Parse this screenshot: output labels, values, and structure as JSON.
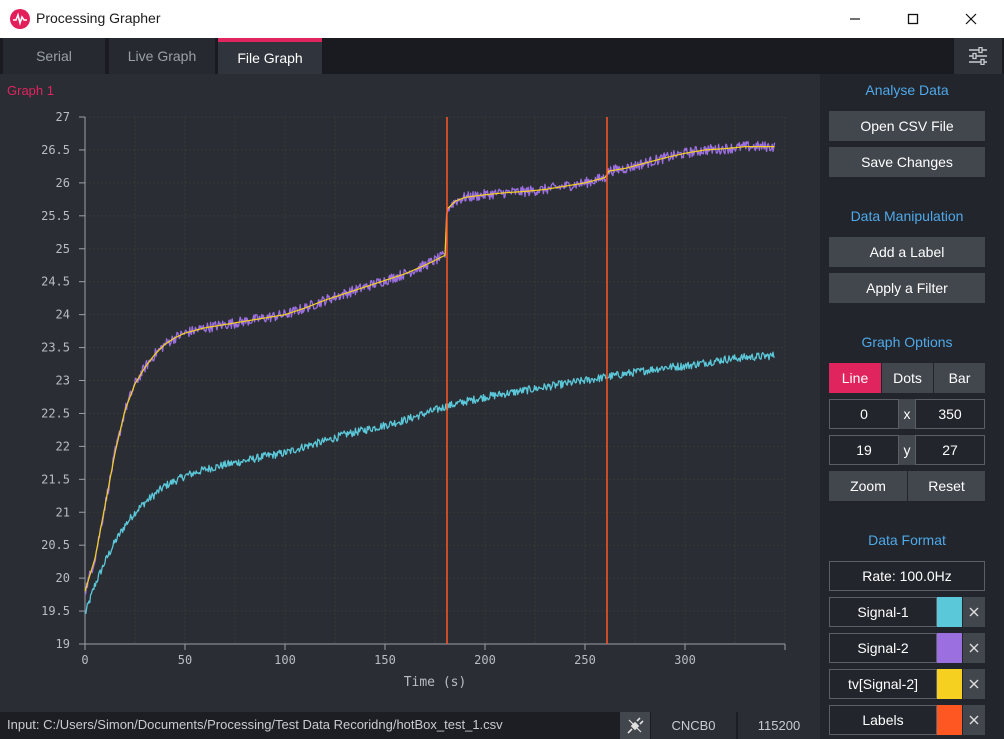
{
  "window": {
    "title": "Processing Grapher"
  },
  "tabs": [
    {
      "label": "Serial",
      "active": false
    },
    {
      "label": "Live Graph",
      "active": false
    },
    {
      "label": "File Graph",
      "active": true
    }
  ],
  "graph": {
    "label": "Graph 1"
  },
  "chart_data": {
    "type": "line",
    "title": "",
    "xlabel": "Time (s)",
    "ylabel": "",
    "xlim": [
      0,
      350
    ],
    "ylim": [
      19,
      27
    ],
    "x_ticks": [
      0,
      50,
      100,
      150,
      200,
      250,
      300
    ],
    "y_ticks": [
      19,
      19.5,
      20,
      20.5,
      21,
      21.5,
      22,
      22.5,
      23,
      23.5,
      24,
      24.5,
      25,
      25.5,
      26,
      26.5,
      27
    ],
    "grid": true,
    "markers": [
      181,
      261
    ],
    "marker_color": "#ff5722",
    "series": [
      {
        "name": "Signal-1",
        "color": "#5bc8d9",
        "noise": 0.06,
        "x": [
          0,
          5,
          10,
          15,
          20,
          25,
          30,
          40,
          50,
          60,
          70,
          80,
          90,
          100,
          110,
          120,
          130,
          140,
          150,
          160,
          170,
          180,
          190,
          200,
          210,
          220,
          230,
          240,
          250,
          260,
          270,
          280,
          290,
          300,
          310,
          320,
          330,
          345
        ],
        "y": [
          19.45,
          19.9,
          20.25,
          20.55,
          20.8,
          21.0,
          21.15,
          21.4,
          21.55,
          21.65,
          21.72,
          21.78,
          21.85,
          21.9,
          22.0,
          22.08,
          22.18,
          22.25,
          22.32,
          22.4,
          22.5,
          22.6,
          22.68,
          22.75,
          22.8,
          22.85,
          22.9,
          22.95,
          23.0,
          23.05,
          23.1,
          23.15,
          23.2,
          23.22,
          23.27,
          23.32,
          23.35,
          23.38
        ]
      },
      {
        "name": "Signal-2",
        "color": "#9b6fe0",
        "noise": 0.08,
        "x": [
          0,
          5,
          10,
          15,
          20,
          25,
          30,
          35,
          40,
          45,
          50,
          60,
          70,
          80,
          90,
          100,
          110,
          120,
          130,
          140,
          150,
          160,
          170,
          180,
          181,
          185,
          190,
          200,
          210,
          220,
          230,
          240,
          250,
          260,
          262,
          270,
          280,
          290,
          300,
          310,
          320,
          330,
          345
        ],
        "y": [
          19.8,
          20.3,
          21.1,
          21.9,
          22.55,
          22.95,
          23.2,
          23.4,
          23.55,
          23.65,
          23.72,
          23.8,
          23.85,
          23.9,
          23.95,
          24.0,
          24.1,
          24.22,
          24.32,
          24.42,
          24.52,
          24.62,
          24.75,
          24.9,
          25.6,
          25.72,
          25.78,
          25.82,
          25.85,
          25.87,
          25.9,
          25.95,
          26.0,
          26.08,
          26.18,
          26.22,
          26.3,
          26.38,
          26.45,
          26.5,
          26.52,
          26.55,
          26.55
        ]
      },
      {
        "name": "tv[Signal-2]",
        "color": "#f5d020",
        "noise": 0,
        "x": [
          0,
          5,
          10,
          15,
          20,
          25,
          30,
          35,
          40,
          45,
          50,
          60,
          70,
          80,
          90,
          100,
          110,
          120,
          130,
          140,
          150,
          160,
          170,
          180,
          181,
          185,
          190,
          200,
          210,
          220,
          230,
          240,
          250,
          260,
          262,
          270,
          280,
          290,
          300,
          310,
          320,
          330,
          345
        ],
        "y": [
          19.8,
          20.3,
          21.1,
          21.9,
          22.55,
          22.95,
          23.2,
          23.4,
          23.55,
          23.65,
          23.72,
          23.8,
          23.85,
          23.9,
          23.95,
          24.0,
          24.1,
          24.22,
          24.32,
          24.42,
          24.52,
          24.62,
          24.75,
          24.9,
          25.6,
          25.72,
          25.78,
          25.82,
          25.85,
          25.87,
          25.9,
          25.95,
          26.0,
          26.08,
          26.18,
          26.22,
          26.3,
          26.38,
          26.45,
          26.5,
          26.52,
          26.55,
          26.55
        ]
      }
    ]
  },
  "sidebar": {
    "analyse_heading": "Analyse Data",
    "open_csv": "Open CSV File",
    "save_changes": "Save Changes",
    "manip_heading": "Data Manipulation",
    "add_label": "Add a Label",
    "apply_filter": "Apply a Filter",
    "options_heading": "Graph Options",
    "graph_types": [
      "Line",
      "Dots",
      "Bar"
    ],
    "x_min": "0",
    "x_sep": "x",
    "x_max": "350",
    "y_min": "19",
    "y_sep": "y",
    "y_max": "27",
    "zoom": "Zoom",
    "reset": "Reset",
    "format_heading": "Data Format",
    "rate": "Rate: 100.0Hz",
    "signals": [
      {
        "name": "Signal-1",
        "color": "#5bc8d9"
      },
      {
        "name": "Signal-2",
        "color": "#9b6fe0"
      },
      {
        "name": "tv[Signal-2]",
        "color": "#f5d020"
      },
      {
        "name": "Labels",
        "color": "#ff5722"
      }
    ]
  },
  "status": {
    "path": "Input: C:/Users/Simon/Documents/Processing/Test Data Recoridng/hotBox_test_1.csv",
    "port": "CNCB0",
    "baud": "115200"
  },
  "colors": {
    "accent": "#e0245e",
    "heading": "#4fa9ea"
  }
}
